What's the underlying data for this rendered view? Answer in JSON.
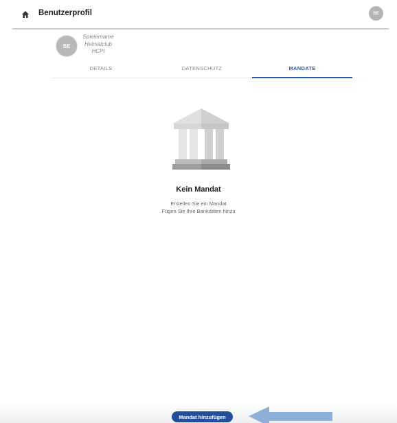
{
  "header": {
    "title": "Benutzerprofil",
    "avatar_initials": "SE",
    "home_icon": "home-icon"
  },
  "profile": {
    "avatar_initials": "SE",
    "player_name": "Spielername",
    "club": "Heimatclub",
    "club_code": "HCPI"
  },
  "tabs": [
    {
      "label": "DETAILS",
      "active": false
    },
    {
      "label": "DATENSCHUTZ",
      "active": false
    },
    {
      "label": "MANDATE",
      "active": true
    }
  ],
  "empty_state": {
    "icon": "bank-icon",
    "title": "Kein Mandat",
    "line1": "Erstellen Sie ein Mandat",
    "line2": "Fügen Sie Ihre Bankdaten hinzu"
  },
  "actions": {
    "add_label": "Mandat hinzufügen"
  },
  "colors": {
    "accent": "#2a5bb3",
    "button": "#1f4e9a",
    "avatar": "#b5b5b5",
    "arrow": "#8fb0d6"
  }
}
